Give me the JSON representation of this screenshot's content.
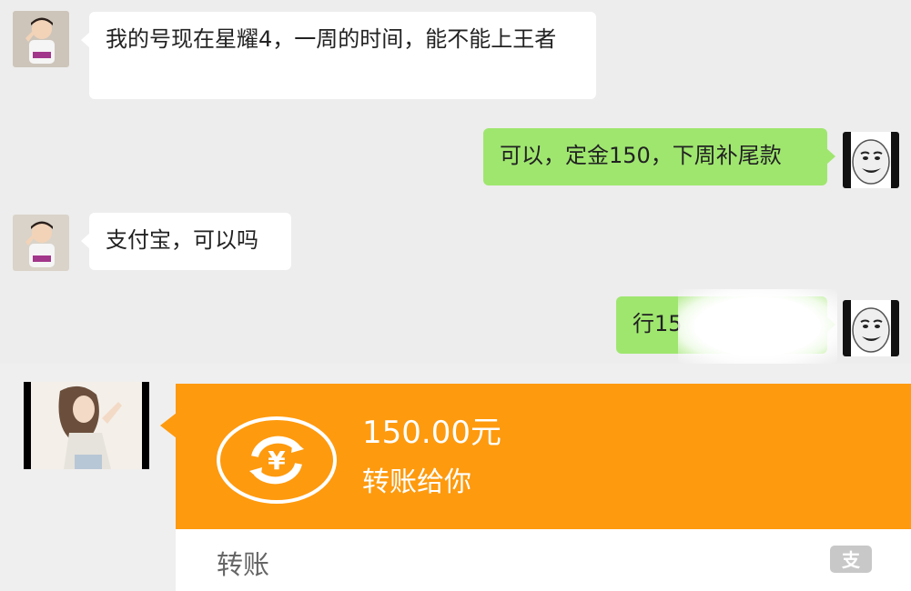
{
  "messages": [
    {
      "side": "left",
      "text": "我的号现在星耀4，一周的时间，能不能上王者"
    },
    {
      "side": "right",
      "text": "可以，定金150，下周补尾款"
    },
    {
      "side": "left",
      "text": "支付宝，可以吗"
    },
    {
      "side": "right",
      "text": "行15"
    }
  ],
  "transfer": {
    "amount": "150.00元",
    "description": "转账给你",
    "label": "转账",
    "icon": "yuan-exchange-icon",
    "footer_icon": "alipay-icon",
    "color": "#fe9a0e"
  },
  "colors": {
    "background": "#ededed",
    "sent_bubble": "#9fe66f",
    "received_bubble": "#ffffff"
  }
}
